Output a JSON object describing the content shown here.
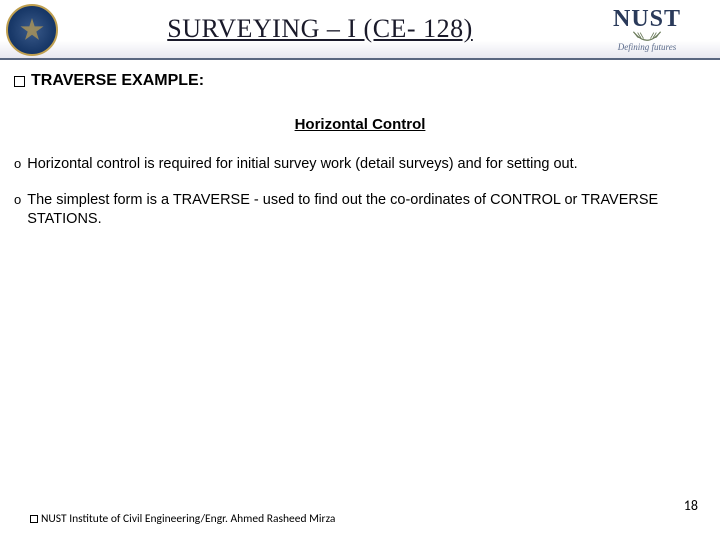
{
  "header": {
    "title": "SURVEYING – I (CE- 128)",
    "right_logo_text": "NUST",
    "right_logo_tagline": "Defining futures"
  },
  "section": {
    "heading": "TRAVERSE EXAMPLE:",
    "subheading": "Horizontal Control",
    "bullets": [
      "Horizontal control is required for initial survey work (detail surveys) and for setting out.",
      "The simplest form is a TRAVERSE - used to find out the co-ordinates of CONTROL or TRAVERSE STATIONS."
    ]
  },
  "footer": {
    "text": "NUST Institute of Civil Engineering/Engr. Ahmed Rasheed Mirza",
    "page": "18"
  }
}
